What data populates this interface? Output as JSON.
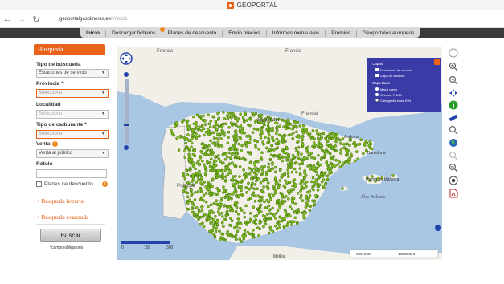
{
  "browser": {
    "app_title": "GEOPORTAL",
    "url_host": "geoportalgasolineras.es",
    "url_path": "/#/Inicio"
  },
  "menu": {
    "items": [
      {
        "label": "Inicio",
        "active": true
      },
      {
        "label": "Descargar ficheros",
        "badge": true
      },
      {
        "label": "Planes de descuento"
      },
      {
        "label": "Envío precios"
      },
      {
        "label": "Informes mensuales"
      },
      {
        "label": "Premios"
      },
      {
        "label": "Geoportales europeos"
      }
    ]
  },
  "search": {
    "title": "Búsqueda",
    "tipo_label": "Tipo de búsqueda",
    "tipo_value": "Estaciones de servicio",
    "provincia_label": "Provincia *",
    "provincia_value": "Seleccione",
    "localidad_label": "Localidad",
    "localidad_value": "Seleccione",
    "carburante_label": "Tipo de carburante *",
    "carburante_value": "Seleccione",
    "venta_label": "Venta",
    "venta_value": "Venta al público",
    "rotulo_label": "Rótulo",
    "planes_label": "Planes de descuento",
    "horaria_label": "+ Búsqueda horaria",
    "avanzada_label": "+ Búsqueda avanzada",
    "buscar_label": "Buscar",
    "required_note": "*campo obligatorio"
  },
  "map": {
    "labels": {
      "francia1": "Francia",
      "francia2": "Francia",
      "francia3": "Francia",
      "santander": "Santander",
      "andorra": "Andorra",
      "barcelona": "Barcelona",
      "portugal": "Portugal",
      "palma": "Palma de Mallorca",
      "baleares": "Illes Balears",
      "melilla": "Melilla"
    },
    "scale_ticks": [
      "0",
      "150",
      "300"
    ],
    "coords": [
      "589150E",
      "4955240.3"
    ],
    "layers": {
      "capas_title": "Capas",
      "estaciones": "Estaciones de servicio",
      "catastro": "Capa de catastro",
      "base_title": "Capa Base",
      "raster": "Mapa raster",
      "ortofoto": "Ortofoto PNOA",
      "cartografia": "Cartografía base IGN"
    }
  },
  "colors": {
    "accent": "#e8621a",
    "sea": "#a9c6e3",
    "land": "#f2efe9",
    "station": "#7cba1e",
    "layers_bg": "#3b3ba8"
  },
  "icons": [
    "pan-icon",
    "zoom-in-icon",
    "zoom-out-icon",
    "move-icon",
    "info-icon",
    "measure-icon",
    "search-map-icon",
    "globe-icon",
    "zoom-in-2-icon",
    "zoom-out-2-icon",
    "location-icon",
    "pdf-icon"
  ]
}
